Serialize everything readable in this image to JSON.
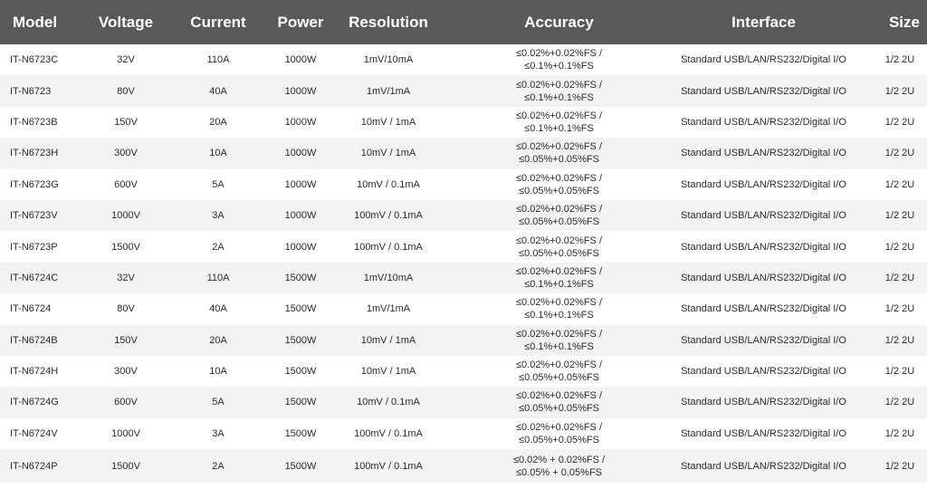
{
  "headers": {
    "model": "Model",
    "voltage": "Voltage",
    "current": "Current",
    "power": "Power",
    "resolution": "Resolution",
    "accuracy": "Accuracy",
    "interface": "Interface",
    "size": "Size"
  },
  "colors": {
    "header_bg": "#58595b",
    "header_text": "#ffffff",
    "row_alt_bg": "#f3f3f3",
    "body_text": "#2b2b2b"
  },
  "rows": [
    {
      "model": "IT-N6723C",
      "voltage": "32V",
      "current": "110A",
      "power": "1000W",
      "resolution": "1mV/10mA",
      "accuracy": "≤0.02%+0.02%FS / ≤0.1%+0.1%FS",
      "interface": "Standard USB/LAN/RS232/Digital I/O",
      "size": "1/2 2U"
    },
    {
      "model": "IT-N6723",
      "voltage": "80V",
      "current": "40A",
      "power": "1000W",
      "resolution": "1mV/1mA",
      "accuracy": "≤0.02%+0.02%FS / ≤0.1%+0.1%FS",
      "interface": "Standard USB/LAN/RS232/Digital I/O",
      "size": "1/2 2U"
    },
    {
      "model": "IT-N6723B",
      "voltage": "150V",
      "current": "20A",
      "power": "1000W",
      "resolution": "10mV / 1mA",
      "accuracy": "≤0.02%+0.02%FS / ≤0.1%+0.1%FS",
      "interface": "Standard USB/LAN/RS232/Digital I/O",
      "size": "1/2 2U"
    },
    {
      "model": "IT-N6723H",
      "voltage": "300V",
      "current": "10A",
      "power": "1000W",
      "resolution": "10mV / 1mA",
      "accuracy": "≤0.02%+0.02%FS / ≤0.05%+0.05%FS",
      "interface": "Standard USB/LAN/RS232/Digital I/O",
      "size": "1/2 2U"
    },
    {
      "model": "IT-N6723G",
      "voltage": "600V",
      "current": "5A",
      "power": "1000W",
      "resolution": "10mV / 0.1mA",
      "accuracy": "≤0.02%+0.02%FS / ≤0.05%+0.05%FS",
      "interface": "Standard USB/LAN/RS232/Digital I/O",
      "size": "1/2 2U"
    },
    {
      "model": "IT-N6723V",
      "voltage": "1000V",
      "current": "3A",
      "power": "1000W",
      "resolution": "100mV / 0.1mA",
      "accuracy": "≤0.02%+0.02%FS / ≤0.05%+0.05%FS",
      "interface": "Standard USB/LAN/RS232/Digital I/O",
      "size": "1/2 2U"
    },
    {
      "model": "IT-N6723P",
      "voltage": "1500V",
      "current": "2A",
      "power": "1000W",
      "resolution": "100mV / 0.1mA",
      "accuracy": "≤0.02%+0.02%FS / ≤0.05%+0.05%FS",
      "interface": "Standard USB/LAN/RS232/Digital I/O",
      "size": "1/2 2U"
    },
    {
      "model": "IT-N6724C",
      "voltage": "32V",
      "current": "110A",
      "power": "1500W",
      "resolution": "1mV/10mA",
      "accuracy": "≤0.02%+0.02%FS / ≤0.1%+0.1%FS",
      "interface": "Standard USB/LAN/RS232/Digital I/O",
      "size": "1/2 2U"
    },
    {
      "model": "IT-N6724",
      "voltage": "80V",
      "current": "40A",
      "power": "1500W",
      "resolution": "1mV/1mA",
      "accuracy": "≤0.02%+0.02%FS / ≤0.1%+0.1%FS",
      "interface": "Standard USB/LAN/RS232/Digital I/O",
      "size": "1/2 2U"
    },
    {
      "model": "IT-N6724B",
      "voltage": "150V",
      "current": "20A",
      "power": "1500W",
      "resolution": "10mV / 1mA",
      "accuracy": "≤0.02%+0.02%FS / ≤0.1%+0.1%FS",
      "interface": "Standard USB/LAN/RS232/Digital I/O",
      "size": "1/2 2U"
    },
    {
      "model": "IT-N6724H",
      "voltage": "300V",
      "current": "10A",
      "power": "1500W",
      "resolution": "10mV / 1mA",
      "accuracy": "≤0.02%+0.02%FS / ≤0.05%+0.05%FS",
      "interface": "Standard USB/LAN/RS232/Digital I/O",
      "size": "1/2 2U"
    },
    {
      "model": "IT-N6724G",
      "voltage": "600V",
      "current": "5A",
      "power": "1500W",
      "resolution": "10mV / 0.1mA",
      "accuracy": "≤0.02%+0.02%FS / ≤0.05%+0.05%FS",
      "interface": "Standard USB/LAN/RS232/Digital I/O",
      "size": "1/2 2U"
    },
    {
      "model": "IT-N6724V",
      "voltage": "1000V",
      "current": "3A",
      "power": "1500W",
      "resolution": "100mV / 0.1mA",
      "accuracy": "≤0.02%+0.02%FS / ≤0.05%+0.05%FS",
      "interface": "Standard USB/LAN/RS232/Digital I/O",
      "size": "1/2 2U"
    },
    {
      "model": "IT-N6724P",
      "voltage": "1500V",
      "current": "2A",
      "power": "1500W",
      "resolution": "100mV / 0.1mA",
      "accuracy": "≤0.02% + 0.02%FS / ≤0.05% + 0.05%FS",
      "interface": "Standard USB/LAN/RS232/Digital I/O",
      "size": "1/2 2U"
    }
  ]
}
